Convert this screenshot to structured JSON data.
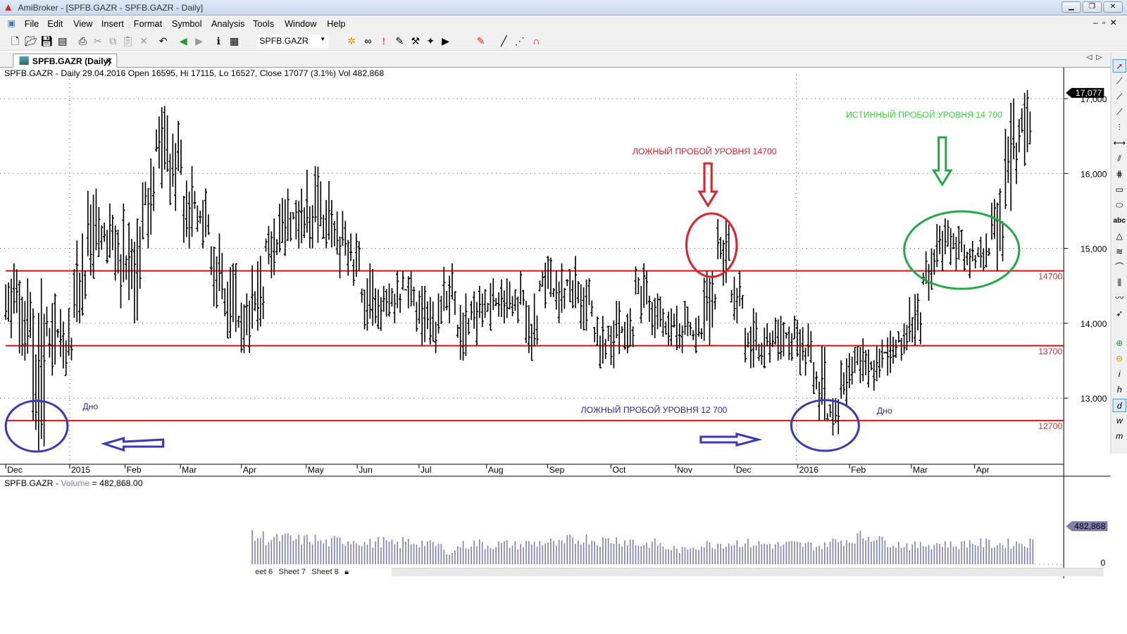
{
  "window": {
    "title": "AmiBroker - [SPFB.GAZR - SPFB.GAZR - Daily]",
    "controls": [
      "minimize",
      "restore",
      "close"
    ]
  },
  "menu": [
    "File",
    "Edit",
    "View",
    "Insert",
    "Format",
    "Symbol",
    "Analysis",
    "Tools",
    "Window",
    "Help"
  ],
  "toolbar": {
    "symbol": "SPFB.GAZR",
    "icons": [
      "new-icon",
      "open-icon",
      "save-icon",
      "save-all-icon",
      "print-icon",
      "cut-icon",
      "copy-icon",
      "paste-icon",
      "delete-icon",
      "undo-icon",
      "back-icon",
      "forward-icon",
      "info-icon",
      "quote-editor-icon",
      "bars-icon",
      "glasses-icon",
      "exclamation-icon",
      "explore-icon",
      "scan-icon",
      "wizard-icon",
      "backtest-icon",
      "color-pen-icon",
      "draw-line-icon",
      "dotted-line-icon",
      "magnet-icon"
    ]
  },
  "tab": {
    "label": "SPFB.GAZR (Daily)"
  },
  "chart_header": "SPFB.GAZR - Daily 29.04.2016 Open 16595, Hi 17115, Lo 16527, Close 17077 (3.1%) Vol 482,868",
  "volume_header": {
    "prefix": "SPFB.GAZR - ",
    "name": "Volume",
    "suffix": " = 482,868.00"
  },
  "chart_data": {
    "type": "ohlc",
    "symbol": "SPFB.GAZR",
    "yticks": [
      13000,
      14000,
      15000,
      16000,
      17000
    ],
    "ylim": [
      12100,
      17500
    ],
    "last_price": "17,077",
    "grid": true,
    "x_ticks": [
      "Dec",
      "2015",
      "Feb",
      "Mar",
      "Apr",
      "May",
      "Jun",
      "Jul",
      "Aug",
      "Sep",
      "Oct",
      "Nov",
      "Dec",
      "2016",
      "Feb",
      "Mar",
      "Apr"
    ],
    "weekly_ranges_low_high": [
      [
        13800,
        14800
      ],
      [
        13500,
        14600
      ],
      [
        12300,
        14600
      ],
      [
        13300,
        14400
      ],
      [
        13300,
        14200
      ],
      [
        14000,
        15200
      ],
      [
        14600,
        15800
      ],
      [
        14800,
        15600
      ],
      [
        14200,
        15600
      ],
      [
        14000,
        15400
      ],
      [
        15000,
        16200
      ],
      [
        15800,
        16900
      ],
      [
        15500,
        16700
      ],
      [
        15000,
        16100
      ],
      [
        15000,
        15800
      ],
      [
        14200,
        15200
      ],
      [
        13800,
        14800
      ],
      [
        13600,
        14400
      ],
      [
        13900,
        14900
      ],
      [
        14600,
        15400
      ],
      [
        14900,
        15800
      ],
      [
        15000,
        15800
      ],
      [
        15000,
        16100
      ],
      [
        15000,
        15900
      ],
      [
        14600,
        15500
      ],
      [
        14500,
        15200
      ],
      [
        13900,
        14800
      ],
      [
        13900,
        14500
      ],
      [
        14000,
        14700
      ],
      [
        14200,
        14700
      ],
      [
        13700,
        14500
      ],
      [
        13600,
        14400
      ],
      [
        14000,
        14800
      ],
      [
        13500,
        14400
      ],
      [
        13700,
        14500
      ],
      [
        13900,
        14600
      ],
      [
        14000,
        14600
      ],
      [
        14000,
        14700
      ],
      [
        13500,
        14400
      ],
      [
        14200,
        14900
      ],
      [
        14000,
        14800
      ],
      [
        14200,
        14900
      ],
      [
        13900,
        14600
      ],
      [
        13400,
        14100
      ],
      [
        13400,
        14300
      ],
      [
        13600,
        14200
      ],
      [
        14000,
        14800
      ],
      [
        13800,
        14400
      ],
      [
        13700,
        14200
      ],
      [
        13600,
        14300
      ],
      [
        13600,
        14100
      ],
      [
        13700,
        14700
      ],
      [
        14500,
        15400
      ],
      [
        14000,
        14700
      ],
      [
        13400,
        14200
      ],
      [
        13400,
        14000
      ],
      [
        13500,
        14100
      ],
      [
        13500,
        14100
      ],
      [
        13300,
        14000
      ],
      [
        12700,
        13700
      ],
      [
        12500,
        13000
      ],
      [
        12900,
        13600
      ],
      [
        13200,
        13800
      ],
      [
        13100,
        13700
      ],
      [
        13300,
        13900
      ],
      [
        13500,
        14000
      ],
      [
        13700,
        14400
      ],
      [
        14300,
        15000
      ],
      [
        14700,
        15400
      ],
      [
        14700,
        15300
      ],
      [
        14600,
        15100
      ],
      [
        14700,
        15200
      ],
      [
        14700,
        15800
      ],
      [
        15500,
        17000
      ],
      [
        16100,
        17115
      ]
    ],
    "levels": [
      {
        "value": 14700,
        "label": "14700"
      },
      {
        "value": 13700,
        "label": "13700"
      },
      {
        "value": 12700,
        "label": "12700"
      }
    ],
    "volume": {
      "last": "482,868",
      "axis_min": "0",
      "start_week": 18,
      "weekly_thousands": [
        330,
        300,
        310,
        290,
        300,
        260,
        280,
        290,
        250,
        270,
        240,
        270,
        260,
        230,
        150,
        230,
        250,
        230,
        240,
        230,
        250,
        260,
        240,
        290,
        310,
        280,
        290,
        280,
        240,
        250,
        190,
        170,
        220,
        240,
        250,
        260,
        250,
        240,
        230,
        240,
        230,
        220,
        270,
        290,
        330,
        340,
        270,
        240,
        220,
        240,
        250,
        230,
        260,
        250,
        240,
        250,
        260,
        260,
        270,
        290,
        330,
        360,
        440,
        470,
        482.868
      ]
    },
    "annotations": [
      {
        "text": "ЛОЖНЫЙ ПРОБОЙ УРОВНЯ 14700",
        "color": "#e0202a"
      },
      {
        "text": "ИСТИННЫЙ ПРОБОЙ УРОВНЯ 14 700",
        "color": "#33dd33"
      },
      {
        "text": "ЛОЖНЫЙ ПРОБОЙ УРОВНЯ 12 700",
        "color": "#2a2aa8"
      },
      {
        "text": "Дно",
        "color": "#2a2aa8"
      },
      {
        "text": "Дно",
        "color": "#2a2aa8"
      }
    ],
    "colors": {
      "bars": "#000000",
      "levels": "#e01010",
      "volume": "#8080b0",
      "false_break": "#e0202a",
      "true_break": "#22aa44",
      "bottom": "#3a3ab8"
    }
  },
  "sheets": [
    "eet 6",
    "Sheet 7",
    "Sheet 8"
  ],
  "draw_tools": [
    "select-arrow-icon",
    "line-icon",
    "ray-icon",
    "extended-line-icon",
    "vertical-line-icon",
    "horizontal-line-icon",
    "parallel-lines-icon",
    "fibonacci-icon",
    "rectangle-icon",
    "ellipse-icon",
    "text-icon",
    "triangle-icon",
    "fibo-fan-icon",
    "arc-icon",
    "cycles-icon",
    "zigzag-icon",
    "arrow-icon",
    "zoom-in-icon",
    "zoom-out-icon",
    "intraday-icon",
    "hourly-icon",
    "daily-icon",
    "weekly-icon",
    "monthly-icon"
  ]
}
